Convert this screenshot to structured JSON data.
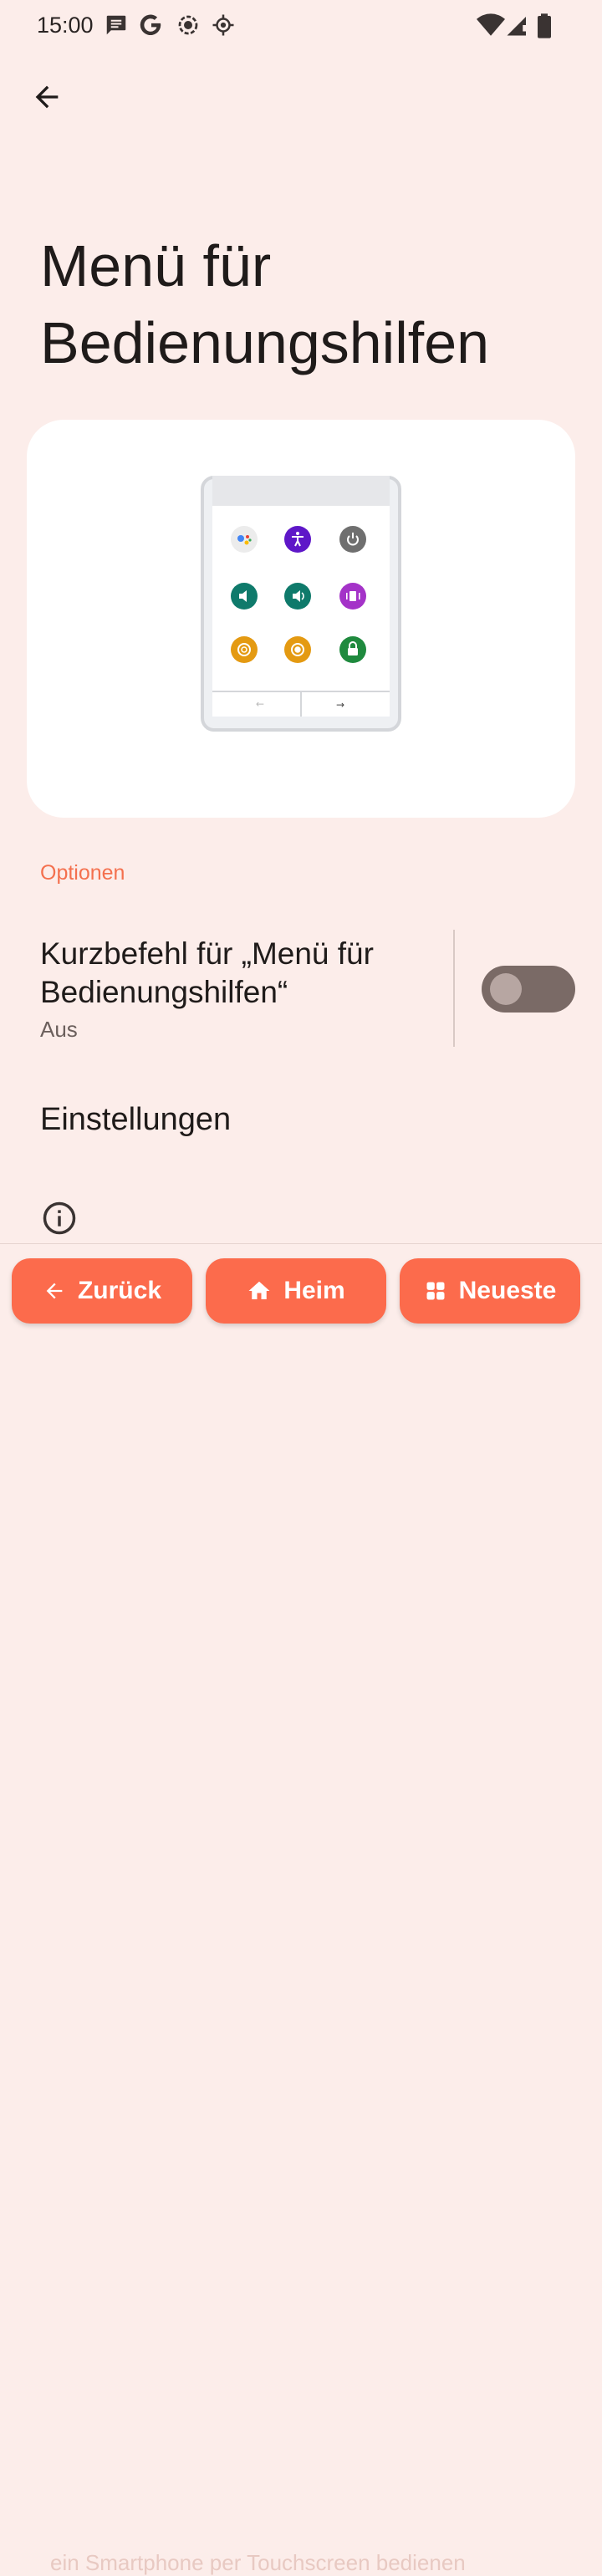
{
  "status_bar": {
    "time": "15:00",
    "icons": [
      "message-icon",
      "google-icon",
      "screen-record-icon",
      "location-icon",
      "wifi-icon",
      "signal-icon",
      "battery-icon"
    ]
  },
  "header": {
    "back_icon": "arrow-back-icon"
  },
  "page": {
    "title": "Menü für Bedienungshilfen"
  },
  "illustration": {
    "grid_colors": [
      "#ececec",
      "#5e17c8",
      "#6f6f6f",
      "#0f7a6b",
      "#0f7a6b",
      "#a433c8",
      "#e49a12",
      "#e49a12",
      "#1f8a3e"
    ],
    "grid_icons": [
      "assistant-icon",
      "accessibility-icon",
      "power-icon",
      "volume-down-icon",
      "volume-up-icon",
      "vibrate-icon",
      "brightness-down-icon",
      "brightness-up-icon",
      "lock-icon"
    ]
  },
  "options": {
    "section_label": "Optionen",
    "shortcut": {
      "title": "Kurzbefehl für „Menü für Bedienungshilfen“",
      "subtitle": "Aus",
      "enabled": false
    },
    "settings_label": "Einstellungen"
  },
  "bottom_nav": {
    "back_label": "Zurück",
    "home_label": "Heim",
    "recents_label": "Neueste",
    "ghost_text": "ein Smartphone per Touchscreen bedienen"
  },
  "colors": {
    "background": "#fcedea",
    "accent": "#f4704e",
    "nav_button": "#fc6b4c"
  }
}
